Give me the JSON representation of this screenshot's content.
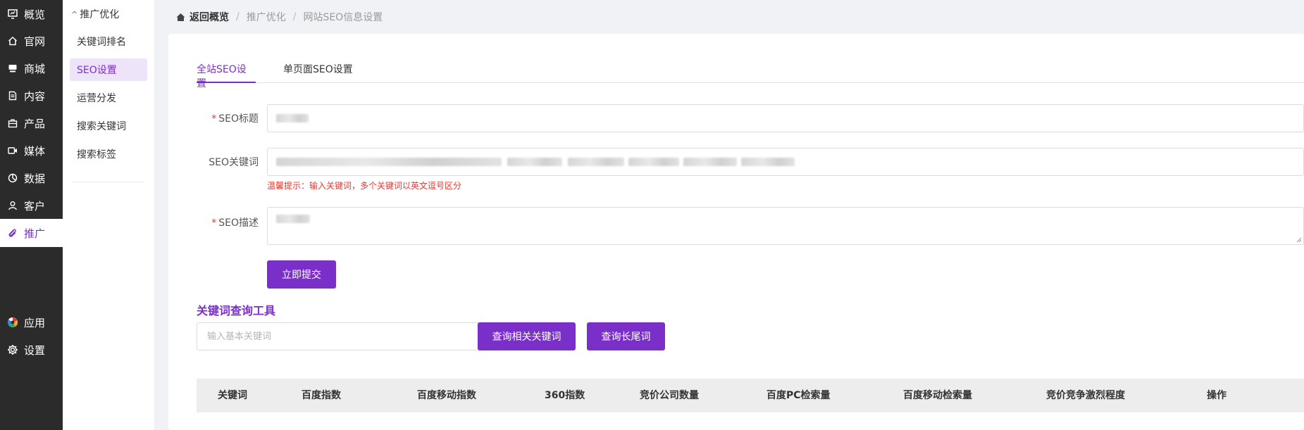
{
  "nav": {
    "items": [
      {
        "label": "概览",
        "icon": "dashboard-icon"
      },
      {
        "label": "官网",
        "icon": "home-icon"
      },
      {
        "label": "商城",
        "icon": "store-icon"
      },
      {
        "label": "内容",
        "icon": "document-icon"
      },
      {
        "label": "产品",
        "icon": "box-icon"
      },
      {
        "label": "媒体",
        "icon": "video-icon"
      },
      {
        "label": "数据",
        "icon": "pie-chart-icon"
      },
      {
        "label": "客户",
        "icon": "user-icon"
      },
      {
        "label": "推广",
        "icon": "link-icon"
      },
      {
        "label": "应用",
        "icon": "apps-icon"
      },
      {
        "label": "设置",
        "icon": "gear-icon"
      }
    ],
    "active_color": "#7b2fc9"
  },
  "subnav": {
    "group": "推广优化",
    "items": [
      "关键词排名",
      "SEO设置",
      "运营分发",
      "搜索关键词",
      "搜索标签"
    ]
  },
  "breadcrumb": {
    "home": "返回概览",
    "parent": "推广优化",
    "current": "网站SEO信息设置"
  },
  "tabs": [
    "全站SEO设置",
    "单页面SEO设置"
  ],
  "form": {
    "title_label": "SEO标题",
    "keywords_label": "SEO关键词",
    "keywords_hint": "温馨提示：输入关键词，多个关键词以英文逗号区分",
    "description_label": "SEO描述",
    "submit_label": "立即提交"
  },
  "keyword_tool": {
    "title": "关键词查询工具",
    "placeholder": "输入基本关键词",
    "btn_related": "查询相关关键词",
    "btn_longtail": "查询长尾词"
  },
  "table": {
    "columns": [
      "关键词",
      "百度指数",
      "百度移动指数",
      "360指数",
      "竞价公司数量",
      "百度PC检索量",
      "百度移动检索量",
      "竞价竞争激烈程度",
      "操作"
    ]
  },
  "colors": {
    "accent": "#7b2fc9",
    "nav_bg": "#2b2b2b",
    "error": "#e53935"
  }
}
